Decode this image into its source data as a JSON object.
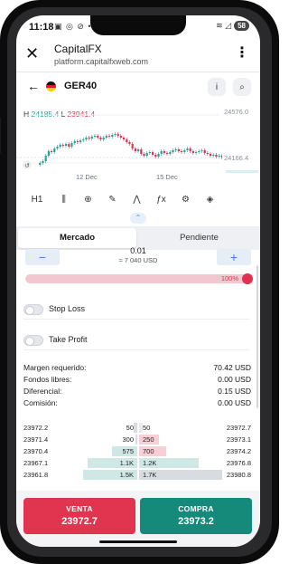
{
  "status_bar": {
    "time": "11:18",
    "icons_left": "▣ ◎ ⊘ •",
    "icons_right": "≋ ◿",
    "battery": "58"
  },
  "browser": {
    "close_glyph": "✕",
    "title": "CapitalFX",
    "url": "platform.capitalfxweb.com",
    "menu_glyph": "⋮"
  },
  "symbol": {
    "back_glyph": "←",
    "name": "GER40",
    "info_glyph": "i",
    "search_glyph": "⌕",
    "flag_colors": [
      "#111111",
      "#dd1c1c",
      "#ffce00"
    ]
  },
  "chart": {
    "high_label": "H",
    "high_value": "24185.4",
    "low_label": "L",
    "low_value": "23941.4",
    "price_top": "24576.0",
    "price_current": "24166.4",
    "date_labels": [
      "12 Dec",
      "15 Dec"
    ],
    "colors": {
      "up": "#22a39a",
      "down": "#e03151"
    }
  },
  "chart_data": {
    "type": "candlestick",
    "x_ticks": [
      "12 Dec",
      "15 Dec"
    ],
    "y_ticks": [
      "24576.0",
      "24166.4"
    ],
    "high": "24185.4",
    "low": "23941.4"
  },
  "toolbar": {
    "timeframe": "H1",
    "tools": [
      "candles-icon",
      "crosshair-icon",
      "pencil-icon",
      "indicator-icon",
      "formula-icon",
      "gear-icon",
      "layers-icon"
    ],
    "glyphs": {
      "candles": "⫼",
      "crosshair": "⊕",
      "pencil": "✎",
      "indicator": "⋀",
      "formula": "ƒx",
      "gear": "⚙",
      "layers": "◈"
    }
  },
  "tabs": {
    "market": "Mercado",
    "pending": "Pendiente"
  },
  "order": {
    "qty": "0.01",
    "usd_value": "≈ 7 040 USD",
    "minus": "−",
    "plus": "+",
    "leverage_pct": "100%",
    "leverage_fraction": 1.0
  },
  "options": {
    "stop_loss": "Stop Loss",
    "take_profit": "Take Profit"
  },
  "summary": [
    {
      "label": "Margen requerido:",
      "value": "70.42 USD"
    },
    {
      "label": "Fondos libres:",
      "value": "0.00 USD"
    },
    {
      "label": "Diferencial:",
      "value": "0.15 USD"
    },
    {
      "label": "Comisión:",
      "value": "0.00 USD"
    }
  ],
  "order_book": [
    {
      "bid_price": "23972.2",
      "bid_qty": "50",
      "ask_qty": "50",
      "ask_price": "23972.7"
    },
    {
      "bid_price": "23971.4",
      "bid_qty": "300",
      "ask_qty": "250",
      "ask_price": "23973.1"
    },
    {
      "bid_price": "23970.4",
      "bid_qty": "575",
      "ask_qty": "700",
      "ask_price": "23974.2"
    },
    {
      "bid_price": "23967.1",
      "bid_qty": "1.1K",
      "ask_qty": "1.2K",
      "ask_price": "23976.8"
    },
    {
      "bid_price": "23961.8",
      "bid_qty": "1.5K",
      "ask_qty": "1.7K",
      "ask_price": "23980.8"
    }
  ],
  "trade": {
    "sell_label": "VENTA",
    "sell_price": "23972.7",
    "buy_label": "COMPRA",
    "buy_price": "23973.2"
  }
}
